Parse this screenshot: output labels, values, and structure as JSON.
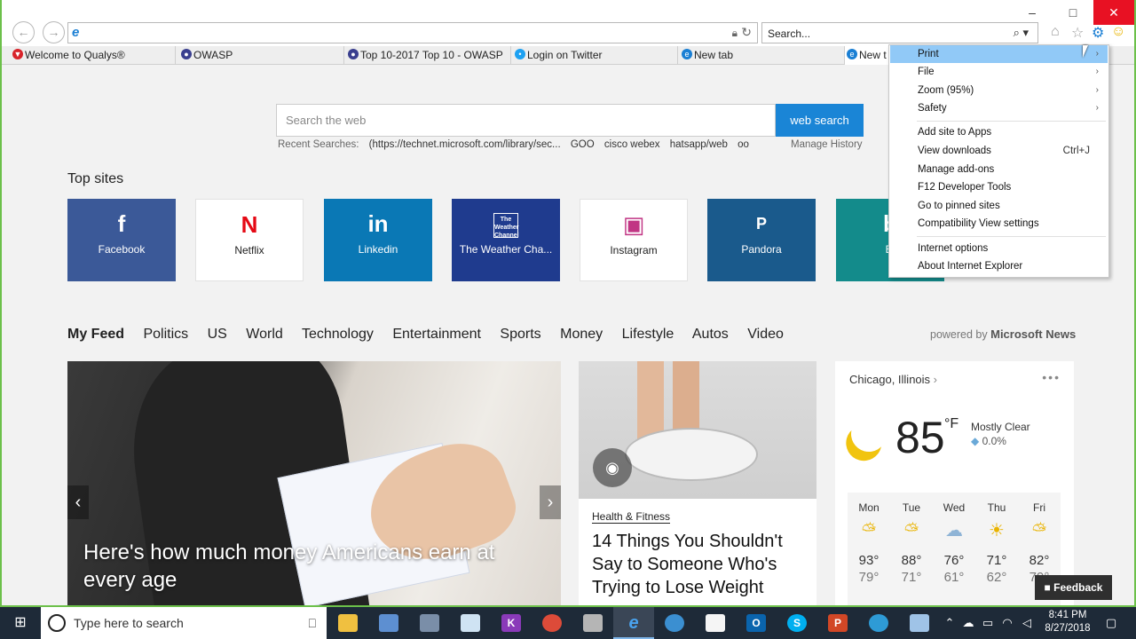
{
  "browser": {
    "search_placeholder": "Search...",
    "tabs": [
      {
        "label": "Welcome to Qualys®"
      },
      {
        "label": "OWASP"
      },
      {
        "label": "Top 10-2017 Top 10 - OWASP"
      },
      {
        "label": "Login on Twitter"
      },
      {
        "label": "New tab"
      },
      {
        "label": "New t"
      }
    ]
  },
  "newtab": {
    "web_search_placeholder": "Search the web",
    "web_search_button": "web search",
    "recent_label": "Recent Searches:",
    "recent": [
      "(https://technet.microsoft.com/library/sec...",
      "GOO",
      "cisco webex",
      "hatsapp/web",
      "oo"
    ],
    "manage_history": "Manage History",
    "top_sites_title": "Top sites",
    "tiles": [
      {
        "label": "Facebook",
        "logo": "f",
        "color": "#3b5998"
      },
      {
        "label": "Netflix",
        "logo": "N",
        "color": "#e50914"
      },
      {
        "label": "Linkedin",
        "logo": "in",
        "color": "#0a78b5"
      },
      {
        "label": "The Weather Cha...",
        "logo": "The Weather Channel",
        "color": "#1f3b8e"
      },
      {
        "label": "Instagram",
        "logo": "▣",
        "color": "#c13584"
      },
      {
        "label": "Pandora",
        "logo": "P",
        "color": "#1a5a8c"
      },
      {
        "label": "Bi",
        "logo": "b",
        "color": "#138b8b"
      }
    ],
    "feed_nav": [
      "My Feed",
      "Politics",
      "US",
      "World",
      "Technology",
      "Entertainment",
      "Sports",
      "Money",
      "Lifestyle",
      "Autos",
      "Video"
    ],
    "powered_prefix": "powered by",
    "powered_brand": "Microsoft News",
    "hero_headline": "Here's how much money Americans earn at every age",
    "card2_category": "Health & Fitness",
    "card2_title": "14 Things You Shouldn't Say to Someone Who's Trying to Lose Weight",
    "weather": {
      "city": "Chicago, Illinois",
      "temp": "85",
      "unit": "°F",
      "condition": "Mostly Clear",
      "precip": "0.0%",
      "days": [
        {
          "name": "Mon",
          "hi": "93°",
          "lo": "79°",
          "icon": "partly-sunny-icon"
        },
        {
          "name": "Tue",
          "hi": "88°",
          "lo": "71°",
          "icon": "partly-sunny-icon"
        },
        {
          "name": "Wed",
          "hi": "76°",
          "lo": "61°",
          "icon": "rain-icon"
        },
        {
          "name": "Thu",
          "hi": "71°",
          "lo": "62°",
          "icon": "sun-icon"
        },
        {
          "name": "Fri",
          "hi": "82°",
          "lo": "79°",
          "icon": "partly-sunny-icon"
        }
      ]
    },
    "feedback": "Feedback"
  },
  "menu": {
    "items": [
      {
        "label": "Print",
        "arrow": "›"
      },
      {
        "label": "File",
        "arrow": "›"
      },
      {
        "label": "Zoom (95%)",
        "arrow": "›"
      },
      {
        "label": "Safety",
        "arrow": "›"
      },
      {
        "label": "Add site to Apps"
      },
      {
        "label": "View downloads",
        "shortcut": "Ctrl+J"
      },
      {
        "label": "Manage add-ons"
      },
      {
        "label": "F12 Developer Tools"
      },
      {
        "label": "Go to pinned sites"
      },
      {
        "label": "Compatibility View settings"
      },
      {
        "label": "Internet options"
      },
      {
        "label": "About Internet Explorer"
      }
    ]
  },
  "taskbar": {
    "search_placeholder": "Type here to search",
    "time": "8:41 PM",
    "date": "8/27/2018"
  }
}
